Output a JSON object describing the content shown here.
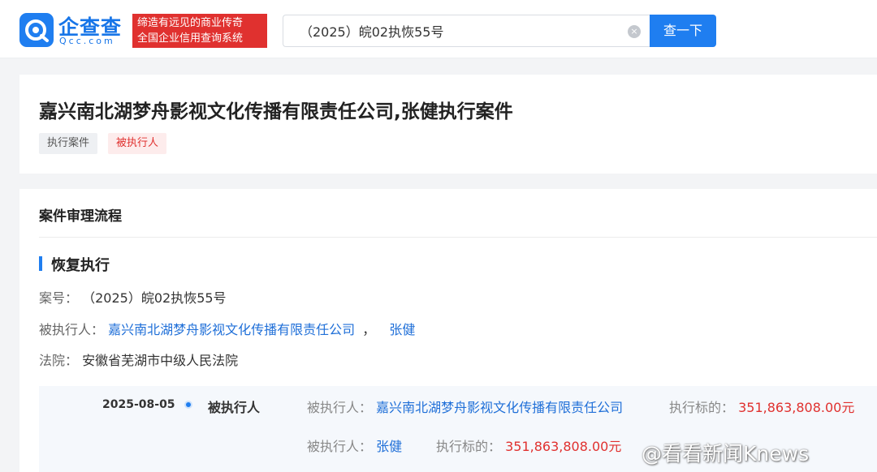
{
  "header": {
    "logo_cn": "企查查",
    "logo_en": "Qcc.com",
    "slogan_line1": "缔造有远见的商业传奇",
    "slogan_line2": "全国企业信用查询系统",
    "search_value": "（2025）皖02执恢55号",
    "clear_glyph": "×",
    "search_button": "查一下"
  },
  "case": {
    "title": "嘉兴南北湖梦舟影视文化传播有限责任公司,张健执行案件",
    "tags": [
      "执行案件",
      "被执行人"
    ]
  },
  "process": {
    "section_title": "案件审理流程",
    "stage_title": "恢复执行",
    "case_no_label": "案号：",
    "case_no": "（2025）皖02执恢55号",
    "executed_label": "被执行人：",
    "executed_company": "嘉兴南北湖梦舟影视文化传播有限责任公司",
    "executed_sep": "，",
    "executed_person": "张健",
    "court_label": "法院：",
    "court": "安徽省芜湖市中级人民法院",
    "timeline": {
      "date": "2025-08-05",
      "role": "被执行人",
      "entries": [
        {
          "label": "被执行人：",
          "name": "嘉兴南北湖梦舟影视文化传播有限责任公司",
          "amount_label": "执行标的：",
          "amount": "351,863,808.00元"
        },
        {
          "label": "被执行人：",
          "name": "张健",
          "amount_label": "执行标的：",
          "amount": "351,863,808.00元"
        }
      ]
    }
  },
  "watermark": "@看看新闻Knews",
  "colors": {
    "brand_blue": "#1f7ef0",
    "slogan_red": "#e0312f",
    "link_blue": "#1f6fd8",
    "amount_red": "#e0312f"
  }
}
